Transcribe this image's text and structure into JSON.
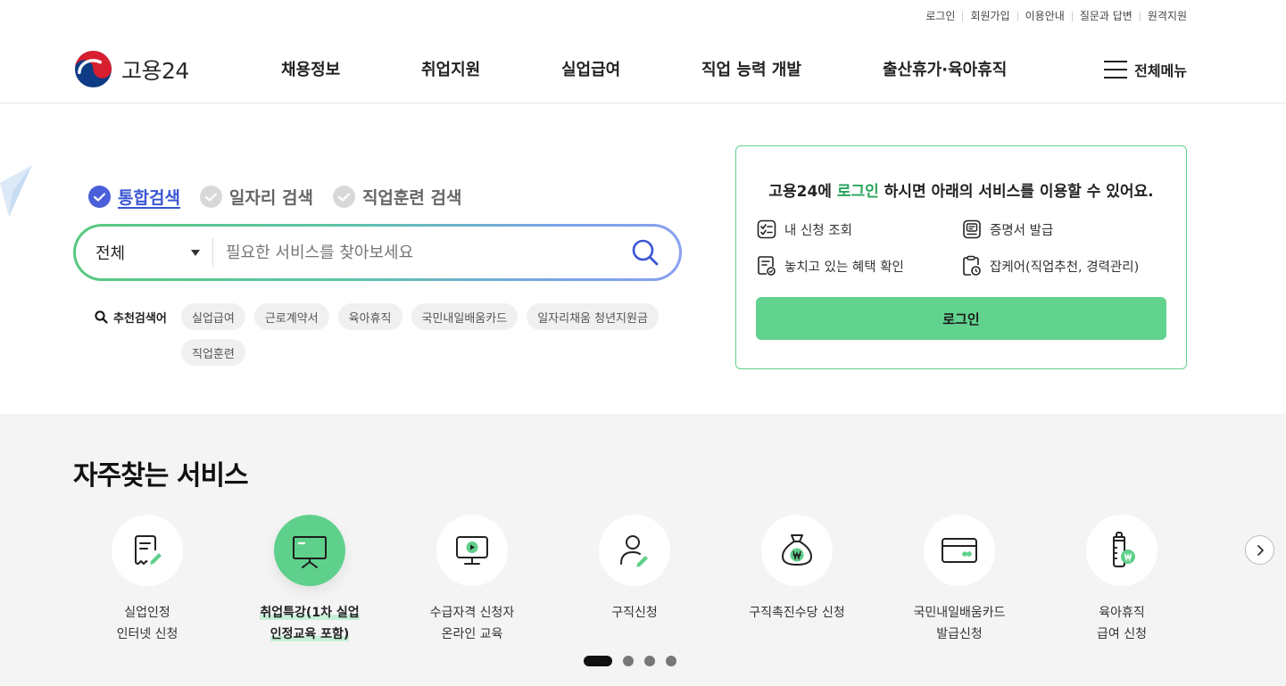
{
  "util_links": [
    "로그인",
    "회원가입",
    "이용안내",
    "질문과 답변",
    "원격지원"
  ],
  "logo_text": "고용24",
  "gnb": [
    "채용정보",
    "취업지원",
    "실업급여",
    "직업 능력 개발",
    "출산휴가·육아휴직"
  ],
  "all_menu": "전체메뉴",
  "search": {
    "tabs": [
      "통합검색",
      "일자리 검색",
      "직업훈련 검색"
    ],
    "active_tab": 0,
    "select_value": "전체",
    "placeholder": "필요한 서비스를 찾아보세요",
    "value": "",
    "rec_label": "추천검색어",
    "chips": [
      "실업급여",
      "근로계약서",
      "육아휴직",
      "국민내일배움카드",
      "일자리채움 청년지원금",
      "직업훈련"
    ]
  },
  "login_card": {
    "title_pre": "고용24에 ",
    "title_hl": "로그인",
    "title_post": " 하시면 아래의 서비스를 이용할 수 있어요.",
    "items": [
      "내 신청 조회",
      "증명서 발급",
      "놓치고 있는 혜택 확인",
      "잡케어(직업추천, 경력관리)"
    ],
    "button": "로그인"
  },
  "frequent": {
    "title": "자주찾는 서비스",
    "items": [
      {
        "line1": "실업인정",
        "line2": "인터넷 신청",
        "icon": "document-pen-icon"
      },
      {
        "line1": "취업특강(1차 실업",
        "line2": "인정교육 포함)",
        "icon": "presentation-board-icon"
      },
      {
        "line1": "수급자격 신청자",
        "line2": "온라인 교육",
        "icon": "video-monitor-icon"
      },
      {
        "line1": "구직신청",
        "line2": "",
        "icon": "person-pen-icon"
      },
      {
        "line1": "구직촉진수당 신청",
        "line2": "",
        "icon": "money-bag-icon"
      },
      {
        "line1": "국민내일배움카드",
        "line2": "발급신청",
        "icon": "card-icon"
      },
      {
        "line1": "육아휴직",
        "line2": "급여 신청",
        "icon": "baby-bottle-icon"
      }
    ],
    "active_item": 1,
    "active_page": 0,
    "pages": 4
  },
  "colors": {
    "accent_green": "#62d38f",
    "accent_blue": "#3a55d4",
    "highlight_green": "#29a35c"
  }
}
